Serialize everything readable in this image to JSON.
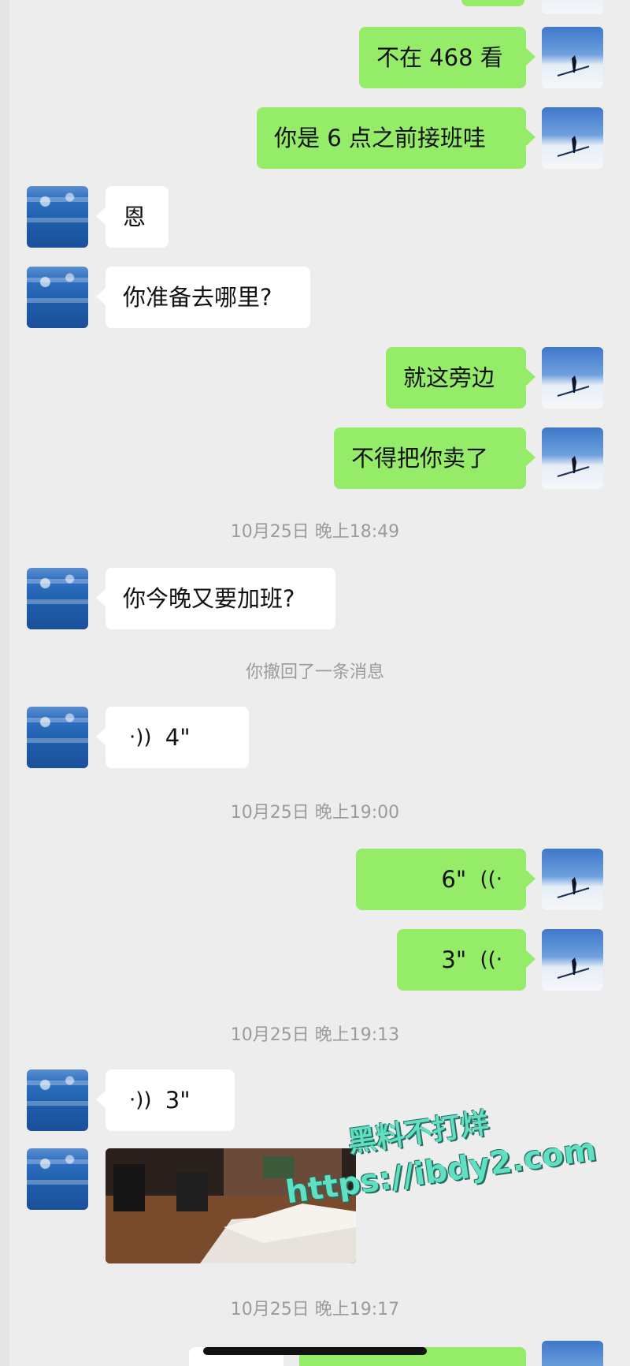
{
  "messages": [
    {
      "text": "不在 468 看"
    },
    {
      "text": "你是 6 点之前接班哇"
    },
    {
      "text": "恩"
    },
    {
      "text": "你准备去哪里?"
    },
    {
      "text": "就这旁边"
    },
    {
      "text": "不得把你卖了"
    },
    {
      "text": "你今晚又要加班?"
    }
  ],
  "timestamps": [
    "10月25日 晚上18:49",
    "10月25日 晚上19:00",
    "10月25日 晚上19:13",
    "10月25日 晚上19:17"
  ],
  "system": {
    "recall": "你撤回了一条消息"
  },
  "voice": [
    {
      "icon": "·))",
      "duration": "4\""
    },
    {
      "icon": "((·",
      "duration": "6\""
    },
    {
      "icon": "((·",
      "duration": "3\""
    },
    {
      "icon": "·))",
      "duration": "3\""
    }
  ],
  "watermark": {
    "line1": "黑料不打烊",
    "line2": "https://ibdy2.com"
  },
  "colors": {
    "outgoing_bubble": "#95ec69",
    "incoming_bubble": "#ffffff",
    "background": "#ededed",
    "watermark": "#5fe0c2"
  }
}
